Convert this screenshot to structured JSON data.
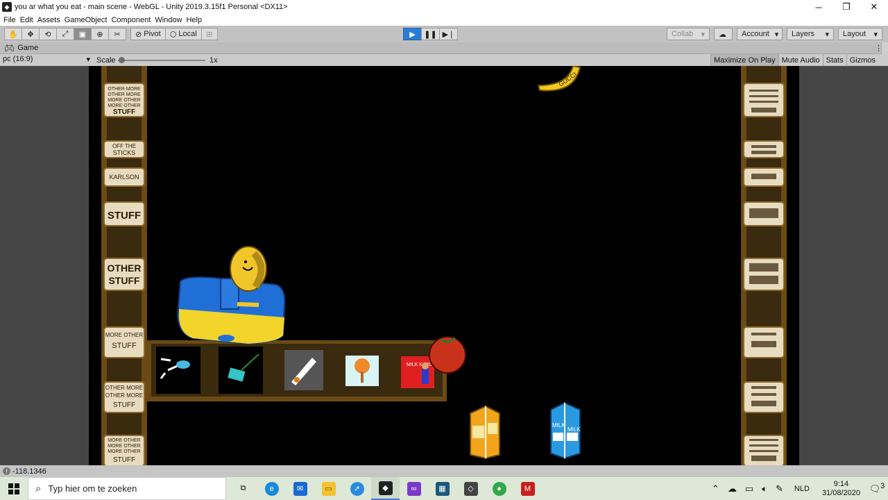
{
  "window": {
    "title": "you ar what you eat - main scene - WebGL - Unity 2019.3.15f1 Personal <DX11>",
    "app_icon": "unity-icon",
    "controls": [
      "minimize-icon",
      "restore-icon",
      "close-icon"
    ]
  },
  "menu": [
    "File",
    "Edit",
    "Assets",
    "GameObject",
    "Component",
    "Window",
    "Help"
  ],
  "toolbar": {
    "tools": [
      "hand-icon",
      "move-icon",
      "rotate-icon",
      "scale-icon",
      "rect-icon",
      "transform-icon",
      "custom-tool-icon"
    ],
    "active_tool": "rect-icon",
    "pivot": "Pivot",
    "local": "Local",
    "collab": "Collab",
    "account": "Account",
    "layers": "Layers",
    "layout": "Layout"
  },
  "game_tab": {
    "label": "Game",
    "resolution": "pc (16:9)",
    "scale_label": "Scale",
    "scale_value": "1x",
    "buttons": [
      "Maximize On Play",
      "Mute Audio",
      "Stats",
      "Gizmos"
    ]
  },
  "game": {
    "left_shelf_labels": [
      [
        "OTHER MORE",
        "OTHER MORE",
        "MORE OTHER",
        "MORE OTHER",
        "STUFF"
      ],
      [
        "OFF THE",
        "STICKS"
      ],
      [
        "KARLSON"
      ],
      [
        "STUFF"
      ],
      [
        "OTHER",
        "STUFF"
      ],
      [
        "MORE OTHER",
        "STUFF"
      ],
      [
        "OTHER MORE",
        "OTHER MORE",
        "STUFF"
      ],
      [
        "MORE OTHER",
        "MORE OTHER",
        "MORE OTHER",
        "STUFF"
      ]
    ],
    "banana_text": "GUCCI",
    "milk_left_text": "MILK",
    "milk_right_text": "MILK",
    "inventory_card_text": "MILK KARLSON"
  },
  "status": {
    "value": "-118.1346"
  },
  "taskbar": {
    "search_placeholder": "Typ hier om te zoeken",
    "language": "NLD",
    "time": "9:14",
    "date": "31/08/2020",
    "notifications": "3"
  }
}
